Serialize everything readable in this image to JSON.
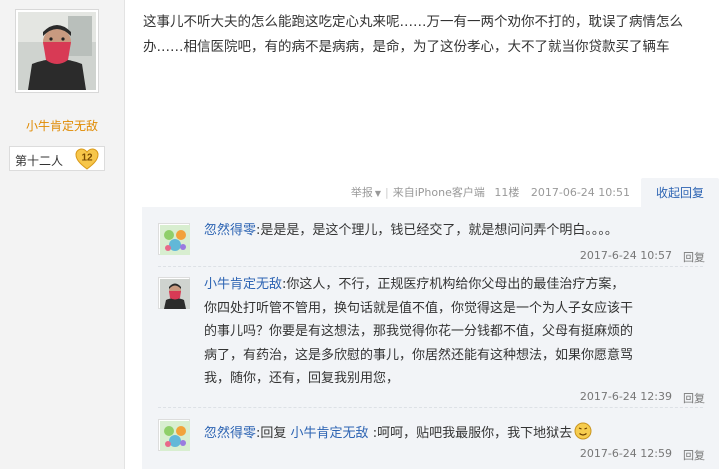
{
  "author": {
    "name": "小牛肯定无敌",
    "level_name": "第十二人",
    "level_number": "12"
  },
  "post": {
    "text": "这事儿不听大夫的怎么能跑这吃定心丸来呢……万一有一两个劝你不打的，耽误了病情怎么办……相信医院吧，有的病不是病病，是命，为了这份孝心，大不了就当你贷款买了辆车",
    "report_label": "举报",
    "client_label": "来自iPhone客户端",
    "floor": "11楼",
    "time": "2017-06-24 10:51",
    "collapse_label": "收起回复"
  },
  "replies": [
    {
      "user": "忽然得零",
      "colon": ":",
      "text": "是是是，是这个理儿，钱已经交了，就是想问问弄个明白。。。。",
      "time": "2017-6-24 10:57",
      "reply_label": "回复"
    },
    {
      "user": "小牛肯定无敌",
      "colon": ":",
      "text": "你这人，不行，正规医疗机构给你父母出的最佳治疗方案，你四处打听管不管用，换句话就是值不值，你觉得这是一个为人子女应该干的事儿吗？你要是有这想法，那我觉得你花一分钱都不值，父母有挺麻烦的病了，有药治，这是多欣慰的事儿，你居然还能有这种想法，如果你愿意骂我，随你，还有，回复我别用您，",
      "time": "2017-6-24 12:39",
      "reply_label": "回复"
    },
    {
      "user": "忽然得零",
      "colon": ":",
      "prefix": "回复 ",
      "target_user": "小牛肯定无敌",
      "text": " :呵呵，贴吧我最服你，我下地狱去",
      "time": "2017-6-24 12:59",
      "reply_label": "回复"
    }
  ]
}
